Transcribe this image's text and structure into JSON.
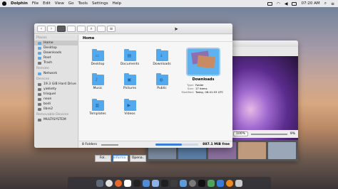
{
  "menubar": {
    "app_name": "Dolphin",
    "menus": [
      "File",
      "Edit",
      "View",
      "Go",
      "Tools",
      "Settings",
      "Help"
    ],
    "clock": "07:20 AM"
  },
  "sidebar": {
    "places_header": "Places",
    "places": [
      {
        "label": "Home",
        "active": true
      },
      {
        "label": "Desktop"
      },
      {
        "label": "Downloads"
      },
      {
        "label": "Root"
      },
      {
        "label": "Trash"
      }
    ],
    "remote_header": "Remote",
    "remote": [
      {
        "label": "Network"
      }
    ],
    "devices_header": "Devices",
    "devices": [
      {
        "label": "19.3 GiB Hard Drive"
      },
      {
        "label": "yakkety"
      },
      {
        "label": "trisquel"
      },
      {
        "label": "neon"
      },
      {
        "label": "bodi"
      },
      {
        "label": "libre2"
      }
    ],
    "removable_header": "Removable Devices",
    "removable": [
      {
        "label": "MULTISYSTEM"
      }
    ]
  },
  "breadcrumb": "Home",
  "folders": [
    {
      "label": "Desktop",
      "glyph": "▭"
    },
    {
      "label": "Documents",
      "glyph": "▤"
    },
    {
      "label": "Downloads",
      "glyph": "↓"
    },
    {
      "label": "Music",
      "glyph": "♪"
    },
    {
      "label": "Pictures",
      "glyph": "▣"
    },
    {
      "label": "Public",
      "glyph": "◍"
    },
    {
      "label": "Templates",
      "glyph": "▥"
    },
    {
      "label": "Videos",
      "glyph": "▶"
    }
  ],
  "preview": {
    "name": "Downloads",
    "rows": [
      {
        "k": "Type:",
        "v": "Folder"
      },
      {
        "k": "Size:",
        "v": "17 items"
      },
      {
        "k": "Modified:",
        "v": "Today, 06:41:53 UTC"
      }
    ]
  },
  "status": {
    "folders": "8 Folders",
    "free": "887.1 MiB free",
    "used_fraction": 0.62
  },
  "viewer": {
    "zoom": "100%",
    "zoom2": "9%",
    "tabs": [
      "Fol..",
      "Informa..",
      "Opena.."
    ]
  },
  "colors": {
    "accent": "#3c7fd9",
    "folder": "#52a9ee"
  }
}
